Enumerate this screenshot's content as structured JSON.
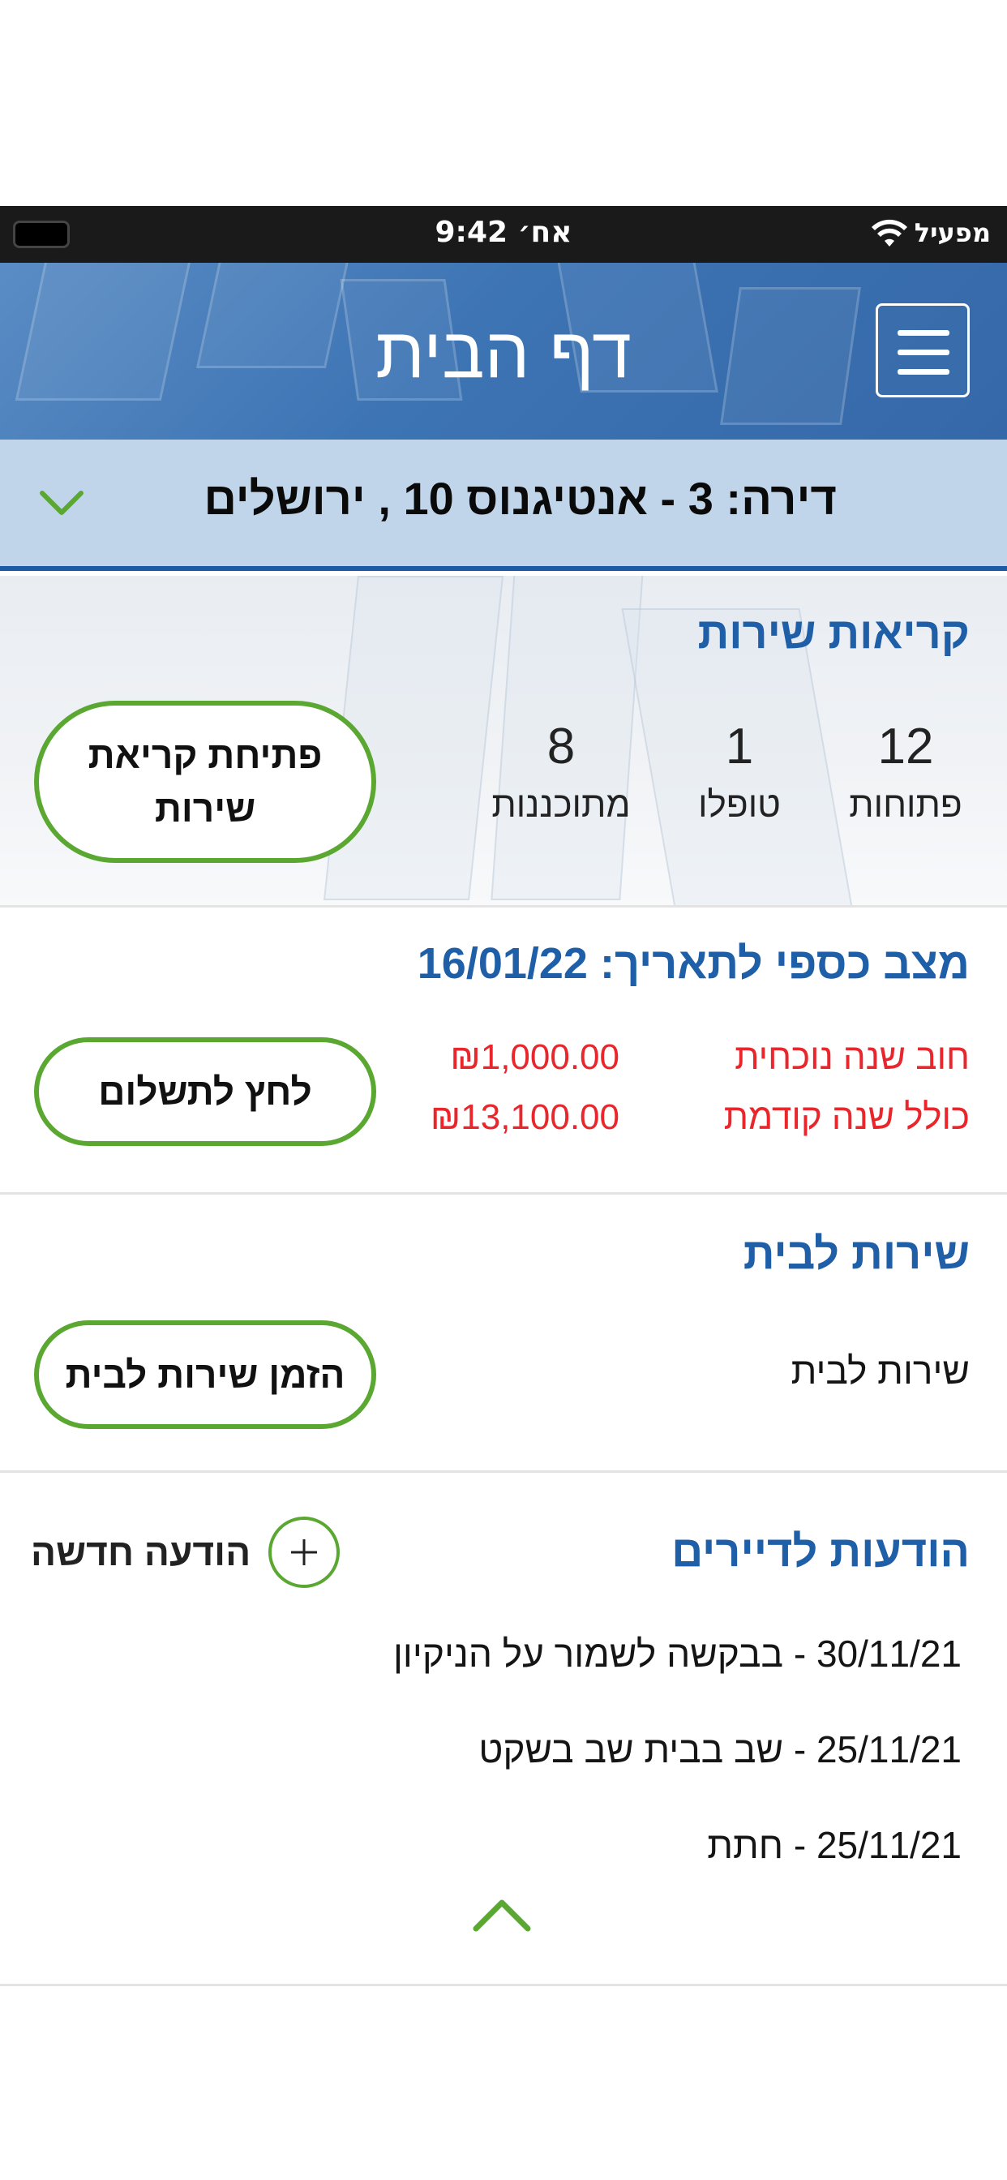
{
  "status_bar": {
    "carrier": "מפעיל",
    "time": "9:42 אח׳"
  },
  "header": {
    "title": "דף הבית",
    "menu_icon": "hamburger-menu-icon"
  },
  "apartment": {
    "label": "דירה: 3 - אנטיגנוס 10 , ירושלים",
    "dropdown_icon": "chevron-down-icon"
  },
  "service_calls": {
    "title": "קריאות שירות",
    "stats": [
      {
        "value": "12",
        "label": "פתוחות"
      },
      {
        "value": "1",
        "label": "טופלו"
      },
      {
        "value": "8",
        "label": "מתוכננות"
      }
    ],
    "open_button_line1": "פתיחת קריאת",
    "open_button_line2": "שירות"
  },
  "finance": {
    "title": "מצב כספי לתאריך: 16/01/22",
    "rows": [
      {
        "label": "חוב שנה נוכחית",
        "amount": "₪1,000.00"
      },
      {
        "label": "כולל שנה קודמת",
        "amount": "₪13,100.00"
      }
    ],
    "pay_button": "לחץ לתשלום",
    "accent_color": "#e8262c"
  },
  "home_service": {
    "title": "שירות לבית",
    "text": "שירות לבית",
    "order_button": "הזמן שירות לבית"
  },
  "messages": {
    "title": "הודעות לדיירים",
    "new_button": "הודעה חדשה",
    "items": [
      "30/11/21 - בבקשה לשמור על הניקיון",
      "25/11/21 - שב בבית שב בשקט",
      "25/11/21 - חתת"
    ],
    "collapse_icon": "chevron-up-icon"
  },
  "colors": {
    "brand_blue": "#1f5fa8",
    "accent_green": "#5aa832",
    "debt_red": "#e8262c"
  }
}
